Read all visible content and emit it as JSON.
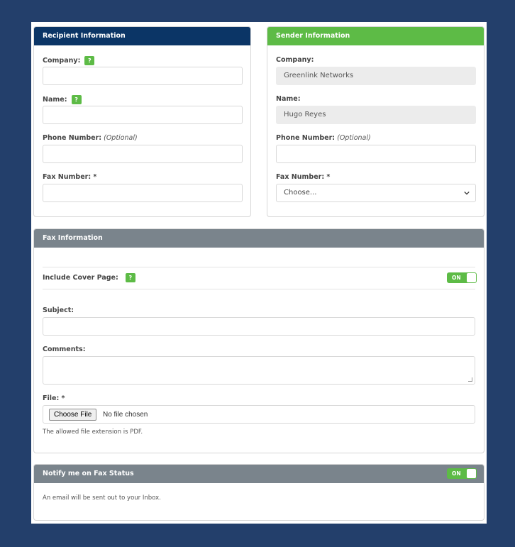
{
  "recipient": {
    "title": "Recipient Information",
    "company_label": "Company:",
    "name_label": "Name:",
    "phone_label": "Phone Number:",
    "phone_optional": "(Optional)",
    "fax_label": "Fax Number: *",
    "help_glyph": "?",
    "company_value": "",
    "name_value": "",
    "phone_value": "",
    "fax_value": ""
  },
  "sender": {
    "title": "Sender Information",
    "company_label": "Company:",
    "company_value": "Greenlink Networks",
    "name_label": "Name:",
    "name_value": "Hugo Reyes",
    "phone_label": "Phone Number:",
    "phone_optional": "(Optional)",
    "phone_value": "",
    "fax_label": "Fax Number: *",
    "fax_selected": "Choose..."
  },
  "fax": {
    "title": "Fax Information",
    "cover_label": "Include Cover Page:",
    "help_glyph": "?",
    "cover_toggle": "ON",
    "subject_label": "Subject:",
    "comments_label": "Comments:",
    "file_label": "File: *",
    "file_button": "Choose File",
    "file_status": "No file chosen",
    "file_hint": "The allowed file extension is PDF."
  },
  "notify": {
    "title": "Notify me on Fax Status",
    "toggle": "ON",
    "message": "An email will be sent out to your Inbox."
  },
  "colors": {
    "background": "#233f6b",
    "recipient_header": "#0b3566",
    "sender_header": "#5dbb46",
    "section_header": "#7a848c",
    "accent_green": "#5dbb46"
  }
}
